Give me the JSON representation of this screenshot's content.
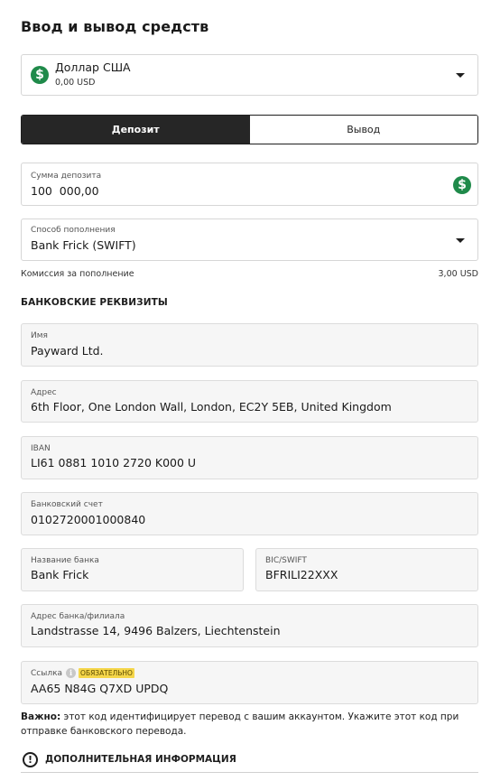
{
  "page": {
    "title": "Ввод и вывод средств"
  },
  "currency": {
    "name": "Доллар США",
    "balance": "0,00 USD",
    "icon": "dollar-circle-icon"
  },
  "tabs": {
    "deposit": "Депозит",
    "withdraw": "Вывод"
  },
  "amount": {
    "label": "Сумма депозита",
    "value": "100  000,00"
  },
  "method": {
    "label": "Способ пополнения",
    "value": "Bank Frick (SWIFT)"
  },
  "fee": {
    "label": "Комиссия за пополнение",
    "value": "3,00 USD"
  },
  "bank_details": {
    "heading": "БАНКОВСКИЕ РЕКВИЗИТЫ",
    "name": {
      "label": "Имя",
      "value": "Payward Ltd."
    },
    "address": {
      "label": "Адрес",
      "value": "6th Floor, One London Wall, London, EC2Y 5EB, United Kingdom"
    },
    "iban": {
      "label": "IBAN",
      "value": "LI61 0881 1010 2720 K000 U"
    },
    "account": {
      "label": "Банковский счет",
      "value": "0102720001000840"
    },
    "bank_name": {
      "label": "Название банка",
      "value": "Bank Frick"
    },
    "swift": {
      "label": "BIC/SWIFT",
      "value": "BFRILI22XXX"
    },
    "bank_address": {
      "label": "Адрес банка/филиала",
      "value": "Landstrasse 14, 9496 Balzers, Liechtenstein"
    },
    "reference": {
      "label": "Ссылка",
      "badge": "ОБЯЗАТЕЛЬНО",
      "value": "AA65 N84G Q7XD UPDQ"
    }
  },
  "note": {
    "bold": "Важно:",
    "text": " этот код идентифицирует перевод с вашим аккаунтом. Укажите этот код при отправке банковского перевода."
  },
  "extra": {
    "label": "ДОПОЛНИТЕЛЬНАЯ ИНФОРМАЦИЯ"
  },
  "colors": {
    "accent_green": "#1f8a4a",
    "dark": "#262626",
    "badge_yellow": "#f5d64a"
  }
}
